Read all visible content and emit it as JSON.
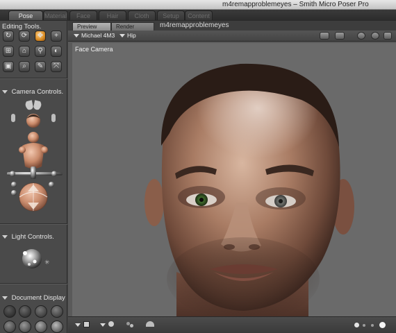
{
  "window": {
    "title": "m4remapproblemeyes – Smith Micro Poser Pro"
  },
  "room_tabs": [
    {
      "label": "Pose",
      "active": true
    },
    {
      "label": "Material",
      "active": false
    },
    {
      "label": "Face",
      "active": false
    },
    {
      "label": "Hair",
      "active": false
    },
    {
      "label": "Cloth",
      "active": false
    },
    {
      "label": "Setup",
      "active": false
    },
    {
      "label": "Content",
      "active": false
    }
  ],
  "left_panel": {
    "editing_tools": {
      "label": "Editing Tools."
    },
    "camera_controls": {
      "label": "Camera Controls."
    },
    "light_controls": {
      "label": "Light Controls."
    },
    "document_display": {
      "label": "Document Display"
    }
  },
  "document": {
    "tabs": [
      {
        "label": "Preview",
        "active": true
      },
      {
        "label": "Render",
        "active": false
      }
    ],
    "name": "m4remapproblemeyes",
    "figure_menu": "Michael 4M3",
    "actor_menu": "Hip",
    "camera_label": "Face Camera"
  },
  "colors": {
    "accent_tool": "#d88a22",
    "viewport_bg": "#6a6a6a",
    "left_eye_iris": "#3f6a2c",
    "right_eye_iris": "#6d6f6a"
  }
}
